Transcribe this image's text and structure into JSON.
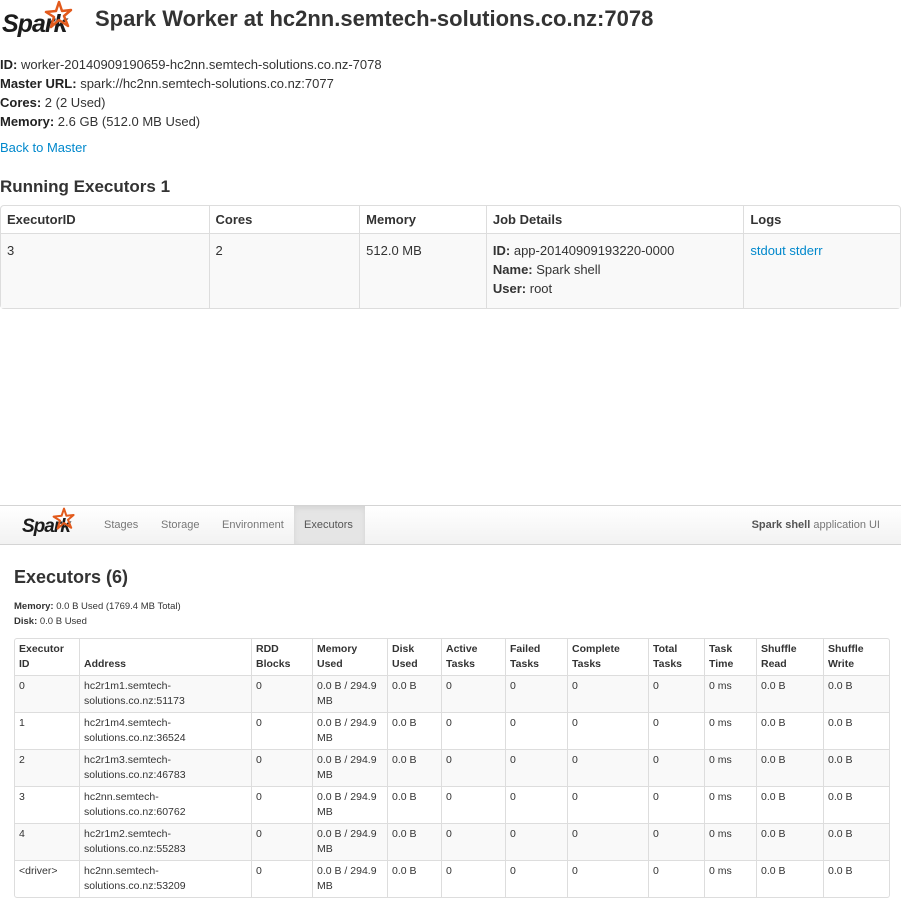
{
  "worker": {
    "logo_text": "Spark",
    "title": "Spark Worker at hc2nn.semtech-solutions.co.nz:7078",
    "id_label": "ID:",
    "id_value": " worker-20140909190659-hc2nn.semtech-solutions.co.nz-7078",
    "master_label": "Master URL:",
    "master_value": " spark://hc2nn.semtech-solutions.co.nz:7077",
    "cores_label": "Cores:",
    "cores_value": " 2 (2 Used)",
    "memory_label": "Memory:",
    "memory_value": " 2.6 GB (512.0 MB Used)",
    "back_link": "Back to Master",
    "running_heading": "Running Executors 1",
    "table": {
      "headers": [
        "ExecutorID",
        "Cores",
        "Memory",
        "Job Details",
        "Logs"
      ],
      "row": {
        "executor_id": "3",
        "cores": "2",
        "memory": "512.0 MB",
        "id_label": "ID:",
        "id_value": " app-20140909193220-0000",
        "name_label": "Name:",
        "name_value": " Spark shell",
        "user_label": "User:",
        "user_value": " root",
        "stdout": "stdout",
        "stderr": "stderr"
      }
    }
  },
  "app": {
    "logo_text": "Spark",
    "tabs": [
      "Stages",
      "Storage",
      "Environment",
      "Executors"
    ],
    "active_tab": "Executors",
    "app_name": "Spark shell",
    "app_ui_suffix": " application UI",
    "heading": "Executors (6)",
    "memory_label": "Memory:",
    "memory_value": " 0.0 B Used (1769.4 MB Total)",
    "disk_label": "Disk:",
    "disk_value": " 0.0 B Used",
    "table": {
      "headers": [
        "Executor ID",
        "Address",
        "RDD Blocks",
        "Memory Used",
        "Disk Used",
        "Active Tasks",
        "Failed Tasks",
        "Complete Tasks",
        "Total Tasks",
        "Task Time",
        "Shuffle Read",
        "Shuffle Write"
      ],
      "rows": [
        [
          "0",
          "hc2r1m1.semtech-solutions.co.nz:51173",
          "0",
          "0.0 B / 294.9 MB",
          "0.0 B",
          "0",
          "0",
          "0",
          "0",
          "0 ms",
          "0.0 B",
          "0.0 B"
        ],
        [
          "1",
          "hc2r1m4.semtech-solutions.co.nz:36524",
          "0",
          "0.0 B / 294.9 MB",
          "0.0 B",
          "0",
          "0",
          "0",
          "0",
          "0 ms",
          "0.0 B",
          "0.0 B"
        ],
        [
          "2",
          "hc2r1m3.semtech-solutions.co.nz:46783",
          "0",
          "0.0 B / 294.9 MB",
          "0.0 B",
          "0",
          "0",
          "0",
          "0",
          "0 ms",
          "0.0 B",
          "0.0 B"
        ],
        [
          "3",
          "hc2nn.semtech-solutions.co.nz:60762",
          "0",
          "0.0 B / 294.9 MB",
          "0.0 B",
          "0",
          "0",
          "0",
          "0",
          "0 ms",
          "0.0 B",
          "0.0 B"
        ],
        [
          "4",
          "hc2r1m2.semtech-solutions.co.nz:55283",
          "0",
          "0.0 B / 294.9 MB",
          "0.0 B",
          "0",
          "0",
          "0",
          "0",
          "0 ms",
          "0.0 B",
          "0.0 B"
        ],
        [
          "<driver>",
          "hc2nn.semtech-solutions.co.nz:53209",
          "0",
          "0.0 B / 294.9 MB",
          "0.0 B",
          "0",
          "0",
          "0",
          "0",
          "0 ms",
          "0.0 B",
          "0.0 B"
        ]
      ]
    }
  },
  "colors": {
    "link": "#0088cc",
    "text": "#333333",
    "logo_star": "#e25a1c",
    "border": "#dddddd"
  },
  "icons": {
    "logo_star": "spark-star-icon"
  }
}
